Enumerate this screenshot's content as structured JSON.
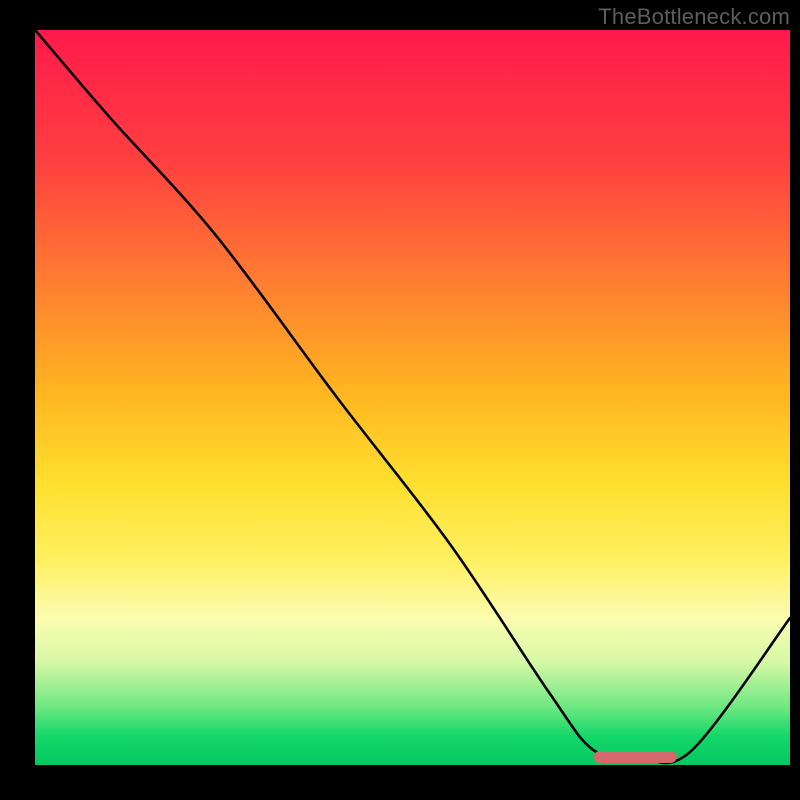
{
  "watermark": "TheBottleneck.com",
  "chart_data": {
    "type": "line",
    "title": "",
    "xlabel": "",
    "ylabel": "",
    "xlim": [
      0,
      100
    ],
    "ylim": [
      0,
      100
    ],
    "series": [
      {
        "name": "bottleneck-curve",
        "x": [
          0,
          10,
          24,
          40,
          55,
          68,
          74,
          80,
          87,
          100
        ],
        "y": [
          100,
          88,
          72,
          50,
          30,
          10,
          2,
          1,
          2,
          20
        ]
      }
    ],
    "optimal_range_x": [
      74,
      85
    ],
    "gradient_stops": [
      {
        "pct": 0,
        "color": "#ff1a4b"
      },
      {
        "pct": 50,
        "color": "#ffb820"
      },
      {
        "pct": 80,
        "color": "#fcfcb0"
      },
      {
        "pct": 100,
        "color": "#00c860"
      }
    ]
  }
}
